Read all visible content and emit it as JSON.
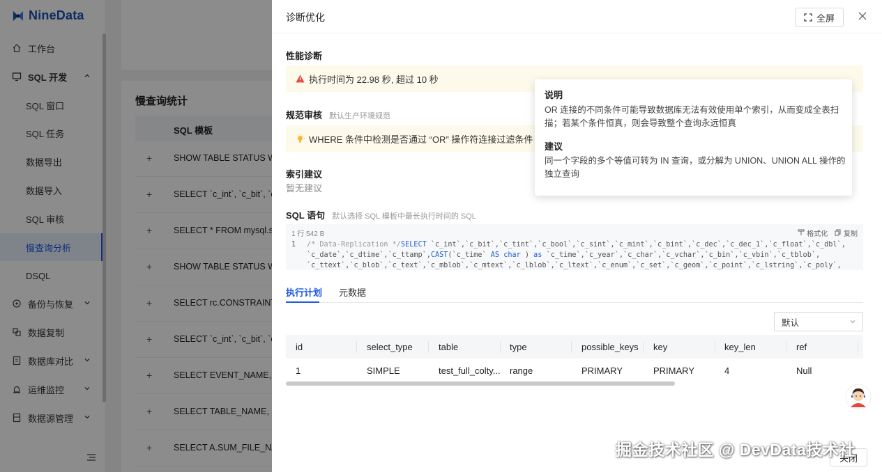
{
  "brand": {
    "name": "NineData"
  },
  "sidebar": {
    "items": [
      {
        "label": "工作台",
        "icon": "home-icon"
      },
      {
        "label": "SQL 开发",
        "icon": "monitor-icon"
      },
      {
        "label": "备份与恢复",
        "icon": "backup-icon"
      },
      {
        "label": "数据复制",
        "icon": "copy-icon"
      },
      {
        "label": "数据库对比",
        "icon": "compare-icon"
      },
      {
        "label": "运维监控",
        "icon": "alarm-icon"
      },
      {
        "label": "数据源管理",
        "icon": "datasource-icon"
      }
    ],
    "sub_items": [
      "SQL 窗口",
      "SQL 任务",
      "数据导出",
      "数据导入",
      "SQL 审核",
      "慢查询分析",
      "DSQL"
    ],
    "active_sub": "慢查询分析"
  },
  "background": {
    "card_title": "慢查询统计",
    "column_header": "SQL 模板",
    "rows": [
      "SHOW TABLE STATUS WHERE",
      "SELECT `c_int`, `c_bit`, `c_tint`",
      "SELECT * FROM mysql.slow_log",
      "SHOW TABLE STATUS WHERE",
      "SELECT rc.CONSTRAINT_NAME",
      "SELECT `c_int`, `c_bit`, `c_tint`",
      "SELECT EVENT_NAME, rc",
      "SELECT TABLE_NAME, PARTITION",
      "SELECT A.SUM_FILE_NAME"
    ]
  },
  "drawer": {
    "title": "诊断优化",
    "fullscreen_label": "全屏",
    "perf": {
      "label": "性能诊断",
      "warning": "执行时间为 22.98 秒, 超过 10 秒"
    },
    "audit": {
      "label": "规范审核",
      "note": "默认生产环境规范",
      "hint": "WHERE 条件中检测是否通过 “OR” 操作符连接过滤条件"
    },
    "index": {
      "label": "索引建议",
      "empty": "暂无建议"
    },
    "sql": {
      "label": "SQL 语句",
      "note": "默认选择 SQL 模板中最长执行时间的 SQL",
      "meta": "1 行  542 B",
      "format_label": "格式化",
      "copy_label": "复制",
      "line_number": "1",
      "line1_comment": "/* Data-Replication */",
      "line1_kw": "SELECT",
      "line1_rest": " `c_int`,`c_bit`,`c_tint`,`c_bool`,`c_sint`,`c_mint`,`c_bint`,`c_dec`,`c_dec_1`,`c_float`,`c_dbl`,",
      "line2a": "`c_date`,`c_dtime`,`c_ttamp`,",
      "line2_kw": "CAST",
      "line2b": "(`c_time` ",
      "line2_as": "AS",
      "line2_char": "char",
      "line2c": " ) ",
      "line2_as2": "as",
      "line2d": " `c_time`,`c_year`,`c_char`,`c_vchar`,`c_bin`,`c_vbin`,`c_tblob`,",
      "line3": "`c_ttext`,`c_blob`,`c_text`,`c_mblob`,`c_mtext`,`c_lblob`,`c_ltext`,`c_enum`,`c_set`,`c_geom`,`c_point`,`c_lstring`,`c_poly`,"
    },
    "tabs": [
      "执行计划",
      "元数据"
    ],
    "select_value": "默认",
    "plan": {
      "columns": [
        "id",
        "select_type",
        "table",
        "type",
        "possible_keys",
        "key",
        "key_len",
        "ref"
      ],
      "rows": [
        [
          "1",
          "SIMPLE",
          "test_full_colty...",
          "range",
          "PRIMARY",
          "PRIMARY",
          "4",
          "Null"
        ]
      ]
    },
    "close_label": "关闭"
  },
  "tooltip": {
    "h1": "说明",
    "p1": "OR 连接的不同条件可能导致数据库无法有效使用单个索引，从而变成全表扫描；若某个条件恒真，则会导致整个查询永远恒真",
    "h2": "建议",
    "p2": "同一个字段的多个等值可转为 IN 查询，或分解为 UNION、UNION ALL 操作的独立查询"
  },
  "watermark": "掘金技术社区 @ DevData技术社"
}
